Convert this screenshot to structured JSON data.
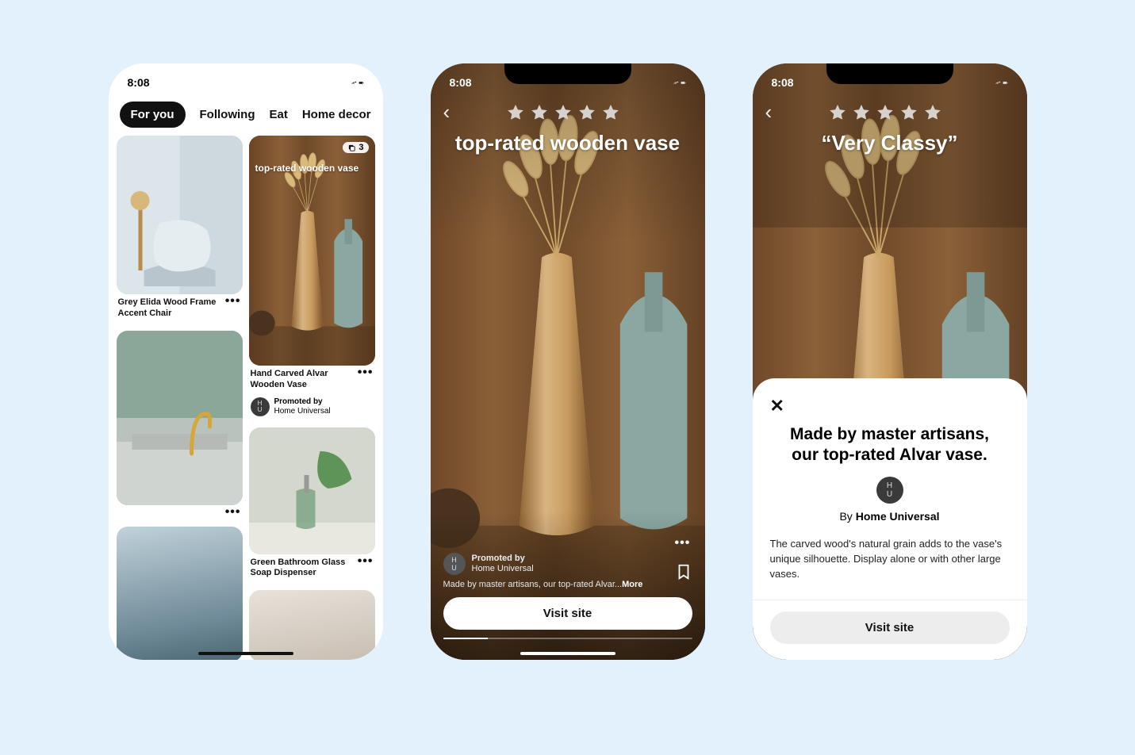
{
  "status": {
    "time": "8:08"
  },
  "feed": {
    "tabs": [
      "For you",
      "Following",
      "Eat",
      "Home decor"
    ],
    "pins": {
      "chair": {
        "title": "Grey Elida Wood Frame Accent Chair"
      },
      "vase": {
        "overlay": "top-rated wooden vase",
        "badge_count": "3",
        "title": "Hand Carved Alvar Wooden Vase",
        "promoted_by_label": "Promoted by",
        "promoted_by_name": "Home Universal"
      },
      "soap": {
        "title": "Green Bathroom Glass Soap Dispenser"
      }
    }
  },
  "detail_a": {
    "headline": "top-rated wooden vase",
    "promoted_by_label": "Promoted by",
    "promoted_by_name": "Home Universal",
    "caption_truncated": "Made by master artisans, our top-rated Alvar...",
    "more_label": "More",
    "cta": "Visit site"
  },
  "detail_b": {
    "headline": "“Very Classy”",
    "sheet": {
      "title": "Made by master artisans, our top-rated Alvar vase.",
      "by_prefix": "By ",
      "by_name": "Home Universal",
      "body": "The carved wood's natural grain adds to the vase's unique silhouette. Display alone or with other large vases.",
      "cta": "Visit site"
    }
  },
  "brand_initials": "H\nU"
}
